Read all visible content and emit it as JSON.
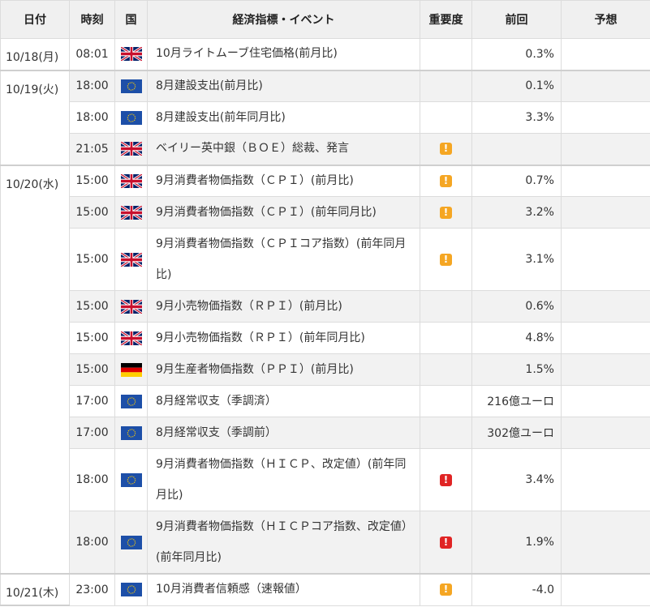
{
  "headers": {
    "date": "日付",
    "time": "時刻",
    "country": "国",
    "event": "経済指標・イベント",
    "importance": "重要度",
    "previous": "前回",
    "forecast": "予想"
  },
  "colors": {
    "header_bg": "#f0f0f0",
    "alt_row": "#f2f2f2",
    "importance_mid": "#f5a623",
    "importance_high": "#e02424"
  },
  "groups": [
    {
      "date": "10/18(月)",
      "rows": [
        {
          "time": "08:01",
          "flag": "uk",
          "event": "10月ライトムーブ住宅価格(前月比)",
          "importance": "",
          "previous": "0.3%",
          "forecast": ""
        }
      ]
    },
    {
      "date": "10/19(火)",
      "rows": [
        {
          "time": "18:00",
          "flag": "eu",
          "event": "8月建設支出(前月比)",
          "importance": "",
          "previous": "0.1%",
          "forecast": ""
        },
        {
          "time": "18:00",
          "flag": "eu",
          "event": "8月建設支出(前年同月比)",
          "importance": "",
          "previous": "3.3%",
          "forecast": ""
        },
        {
          "time": "21:05",
          "flag": "uk",
          "event": "ベイリー英中銀（ＢＯＥ）総裁、発言",
          "importance": "mid",
          "previous": "",
          "forecast": ""
        }
      ]
    },
    {
      "date": "10/20(水)",
      "rows": [
        {
          "time": "15:00",
          "flag": "uk",
          "event": "9月消費者物価指数（ＣＰＩ）(前月比)",
          "importance": "mid",
          "previous": "0.7%",
          "forecast": ""
        },
        {
          "time": "15:00",
          "flag": "uk",
          "event": "9月消費者物価指数（ＣＰＩ）(前年同月比)",
          "importance": "mid",
          "previous": "3.2%",
          "forecast": ""
        },
        {
          "time": "15:00",
          "flag": "uk",
          "event": "9月消費者物価指数（ＣＰＩコア指数）(前年同月比)",
          "importance": "mid",
          "previous": "3.1%",
          "forecast": "",
          "multi": true
        },
        {
          "time": "15:00",
          "flag": "uk",
          "event": "9月小売物価指数（ＲＰＩ）(前月比)",
          "importance": "",
          "previous": "0.6%",
          "forecast": ""
        },
        {
          "time": "15:00",
          "flag": "uk",
          "event": "9月小売物価指数（ＲＰＩ）(前年同月比)",
          "importance": "",
          "previous": "4.8%",
          "forecast": ""
        },
        {
          "time": "15:00",
          "flag": "de",
          "event": "9月生産者物価指数（ＰＰＩ）(前月比)",
          "importance": "",
          "previous": "1.5%",
          "forecast": ""
        },
        {
          "time": "17:00",
          "flag": "eu",
          "event": "8月経常収支（季調済）",
          "importance": "",
          "previous": "216億ユーロ",
          "forecast": ""
        },
        {
          "time": "17:00",
          "flag": "eu",
          "event": "8月経常収支（季調前）",
          "importance": "",
          "previous": "302億ユーロ",
          "forecast": ""
        },
        {
          "time": "18:00",
          "flag": "eu",
          "event": "9月消費者物価指数（ＨＩＣＰ、改定値）(前年同月比)",
          "importance": "high",
          "previous": "3.4%",
          "forecast": "",
          "multi": true
        },
        {
          "time": "18:00",
          "flag": "eu",
          "event": "9月消費者物価指数（ＨＩＣＰコア指数、改定値）(前年同月比)",
          "importance": "high",
          "previous": "1.9%",
          "forecast": "",
          "multi": true
        }
      ]
    },
    {
      "date": "10/21(木)",
      "rows": [
        {
          "time": "23:00",
          "flag": "eu",
          "event": "10月消費者信頼感（速報値）",
          "importance": "mid",
          "previous": "-4.0",
          "forecast": ""
        }
      ]
    }
  ]
}
